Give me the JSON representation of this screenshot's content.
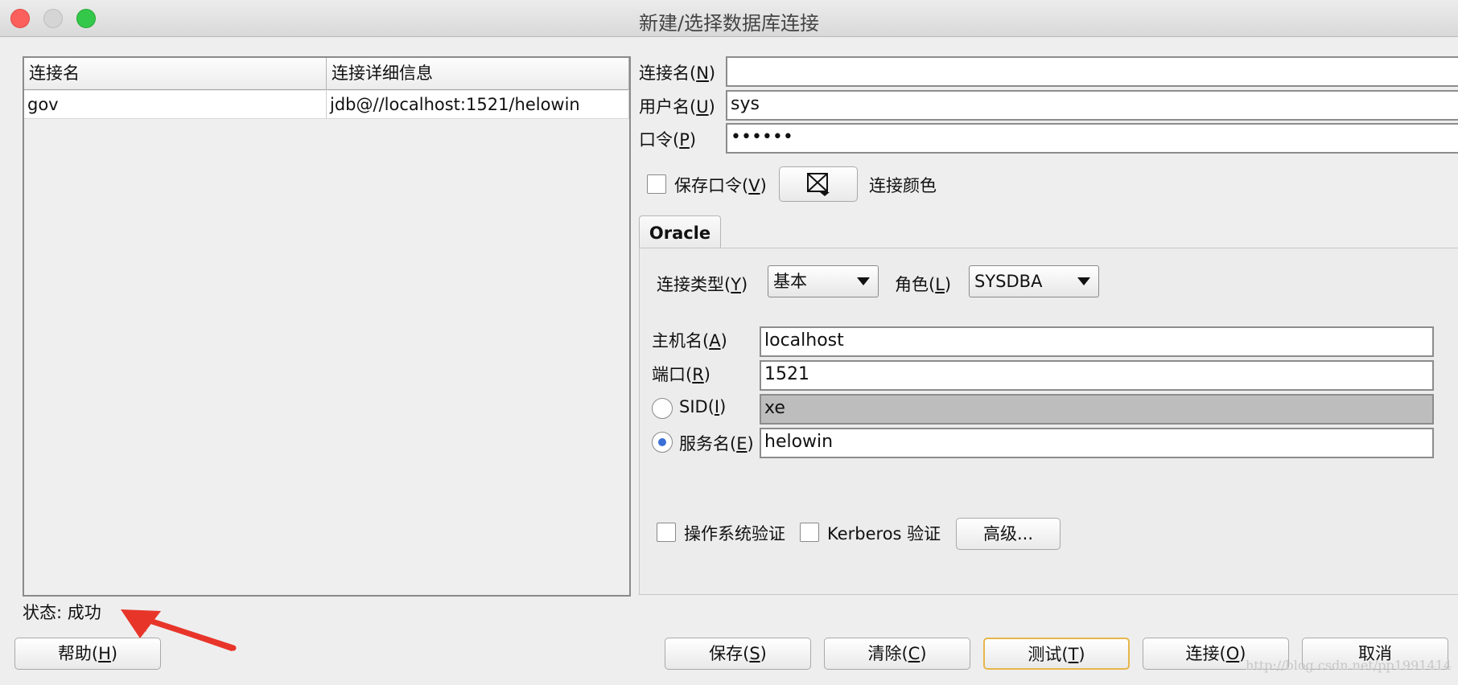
{
  "window": {
    "title": "新建/选择数据库连接"
  },
  "table": {
    "headers": [
      "连接名",
      "连接详细信息"
    ],
    "rows": [
      {
        "name": "gov",
        "detail": "jdb@//localhost:1521/helowin"
      }
    ]
  },
  "status": "状态: 成功",
  "form": {
    "conn_name_label": "连接名(",
    "conn_name_key": "N",
    "user_label": "用户名(",
    "user_key": "U",
    "user_value": "sys",
    "pwd_label": "口令(",
    "pwd_key": "P",
    "pwd_value": "••••••",
    "save_pwd_label": "保存口令(",
    "save_pwd_key": "V",
    "color_label": "连接颜色"
  },
  "tabs": {
    "active": "Oracle"
  },
  "oracle": {
    "conn_type_label": "连接类型(",
    "conn_type_key": "Y",
    "conn_type_value": "基本",
    "role_label": "角色(",
    "role_key": "L",
    "role_value": "SYSDBA",
    "host_label": "主机名(",
    "host_key": "A",
    "host_value": "localhost",
    "port_label": "端口(",
    "port_key": "R",
    "port_value": "1521",
    "sid_label": "SID(",
    "sid_key": "I",
    "sid_value": "xe",
    "service_label": "服务名(",
    "service_key": "E",
    "service_value": "helowin",
    "os_auth_label": "操作系统验证",
    "kerberos_label": "Kerberos 验证",
    "advanced_label": "高级..."
  },
  "buttons": {
    "help": {
      "label": "帮助(",
      "key": "H"
    },
    "save": {
      "label": "保存(",
      "key": "S"
    },
    "clear": {
      "label": "清除(",
      "key": "C"
    },
    "test": {
      "label": "测试(",
      "key": "T"
    },
    "connect": {
      "label": "连接(",
      "key": "O"
    },
    "cancel": {
      "label": "取消"
    }
  },
  "watermark": "http://blog.csdn.net/pp1991414",
  "colors": {
    "accent_border": "#e8b54a",
    "radio_dot": "#3a6fd8",
    "arrow": "#e8352a"
  }
}
